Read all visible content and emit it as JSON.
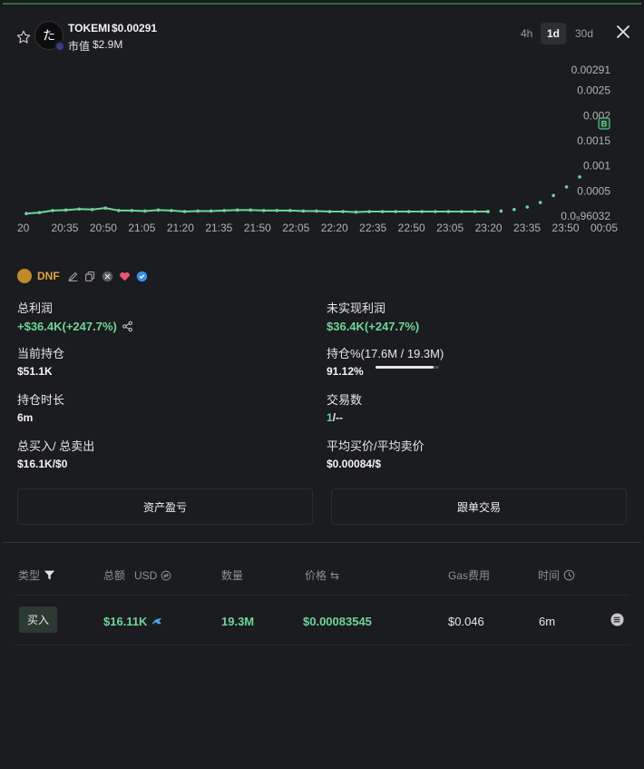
{
  "header": {
    "token_avatar_glyph": "た",
    "token_name": "TOKEMI",
    "token_price": "$0.00291",
    "mcap_label": "市值",
    "mcap_value": "$2.9M",
    "timeframes": [
      "4h",
      "1d",
      "30d"
    ],
    "active_timeframe": "1d"
  },
  "chart_data": {
    "type": "line",
    "x_tick_labels": [
      "20",
      "20:35",
      "20:50",
      "21:05",
      "21:20",
      "21:35",
      "21:50",
      "22:05",
      "22:20",
      "22:35",
      "22:50",
      "23:05",
      "23:20",
      "23:35",
      "23:50",
      "00:05"
    ],
    "y_tick_labels": [
      "0.00291",
      "0.0025",
      "0.002",
      "0.0015",
      "0.001",
      "0.0005",
      "0.0₉96032"
    ],
    "ylim": [
      0,
      0.00291
    ],
    "series": [
      {
        "line_values": [
          5e-05,
          7e-05,
          0.00011,
          0.00012,
          0.00014,
          0.00013,
          0.00016,
          0.00011,
          0.00011,
          0.0001,
          0.00012,
          0.00011,
          9e-05,
          0.0001,
          0.0001,
          0.00011,
          0.00012,
          0.00012,
          0.00011,
          0.00011,
          0.00011,
          0.0001,
          0.0001,
          9e-05,
          9e-05,
          8e-05,
          9e-05,
          9e-05,
          9e-05,
          9e-05,
          9e-05,
          9e-05,
          9e-05,
          9e-05,
          9e-05,
          9e-05
        ],
        "dotted_values": [
          9e-05,
          0.0001,
          0.00013,
          0.00018,
          0.00027,
          0.00041,
          0.00058,
          0.00078
        ]
      }
    ],
    "buy_marker": "B",
    "line_color": "#6fd59a"
  },
  "trader": {
    "name": "DNF"
  },
  "stats": {
    "total_profit_label": "总利润",
    "total_profit_value": "+$36.4K(+247.7%)",
    "unrealized_label": "未实现利润",
    "unrealized_value": "$36.4K(+247.7%)",
    "holding_label": "当前持仓",
    "holding_value": "$51.1K",
    "holding_pct_label": "持仓%(17.6M / 19.3M)",
    "holding_pct_value": "91.12%",
    "holding_pct_fraction": 0.9112,
    "hold_time_label": "持仓时长",
    "hold_time_value": "6m",
    "trades_label": "交易数",
    "trades_buy": "1",
    "trades_sell": "/--",
    "total_buy_sell_label": "总买入/ 总卖出",
    "total_buy_sell_value": "$16.1K/$0",
    "avg_price_label": "平均买价/平均卖价",
    "avg_price_value": "$0.00084/$"
  },
  "buttons": {
    "pnl": "资产盈亏",
    "copy_trade": "跟单交易"
  },
  "table": {
    "headers": {
      "type": "类型",
      "amount": "总额",
      "amount_unit": "USD",
      "qty": "数量",
      "price": "价格",
      "price_swap": "⇆",
      "gas": "Gas费用",
      "time": "时间"
    },
    "rows": [
      {
        "type": "买入",
        "amount": "$16.11K",
        "qty": "19.3M",
        "price": "$0.00083545",
        "gas": "$0.046",
        "time": "6m"
      }
    ]
  },
  "colors": {
    "accent_green": "#6fd59a",
    "background": "#1b1c1f",
    "trader_orange": "#e0a43a"
  }
}
